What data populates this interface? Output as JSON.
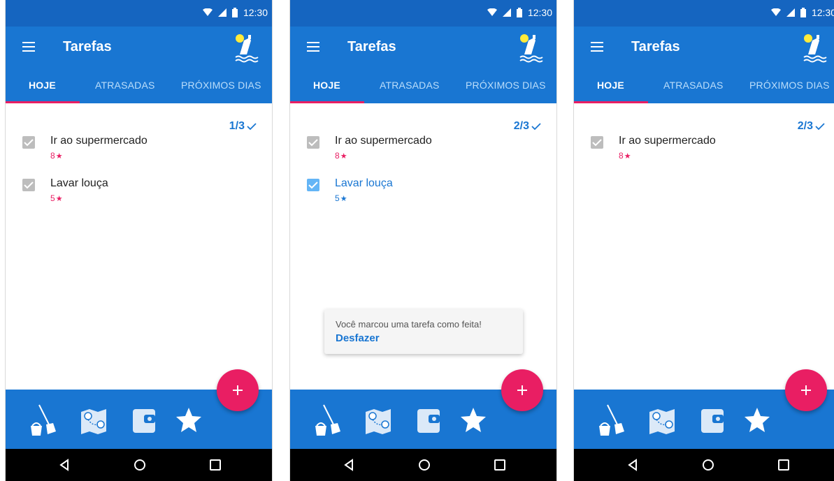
{
  "colors": {
    "status_bar": "#1565c0",
    "app_bar": "#1976d2",
    "accent_pink": "#e91e63",
    "checkbox_gray": "#bdbdbd",
    "checkbox_blue": "#64b5f6",
    "snackbar_bg": "#f5f5f5"
  },
  "screens": [
    {
      "status": {
        "time": "12:30",
        "icons": [
          "wifi-icon",
          "cell-signal-icon",
          "battery-icon"
        ]
      },
      "app": {
        "title": "Tarefas",
        "logo_icon": "bottle-logo-icon"
      },
      "tabs": [
        {
          "label": "HOJE",
          "active": true
        },
        {
          "label": "ATRASADAS",
          "active": false
        },
        {
          "label": "PRÓXIMOS DIAS",
          "active": false
        }
      ],
      "count": "1/3",
      "tasks": [
        {
          "title": "Ir ao supermercado",
          "stars": "8",
          "checked": false,
          "highlight": false
        },
        {
          "title": "Lavar louça",
          "stars": "5",
          "checked": false,
          "highlight": false
        }
      ],
      "bottom_nav": [
        "broom-bucket-icon",
        "map-icon",
        "wallet-icon",
        "star-icon"
      ],
      "fab_icon": "plus-icon",
      "system_nav": [
        "back-icon",
        "home-icon",
        "recents-icon"
      ]
    },
    {
      "status": {
        "time": "12:30",
        "icons": [
          "wifi-icon",
          "cell-signal-icon",
          "battery-icon"
        ]
      },
      "app": {
        "title": "Tarefas",
        "logo_icon": "bottle-logo-icon"
      },
      "tabs": [
        {
          "label": "HOJE",
          "active": true
        },
        {
          "label": "ATRASADAS",
          "active": false
        },
        {
          "label": "PRÓXIMOS DIAS",
          "active": false
        }
      ],
      "count": "2/3",
      "tasks": [
        {
          "title": "Ir ao supermercado",
          "stars": "8",
          "checked": false,
          "highlight": false
        },
        {
          "title": "Lavar louça",
          "stars": "5",
          "checked": true,
          "highlight": true
        }
      ],
      "snackbar": {
        "message": "Você marcou uma tarefa como feita!",
        "action": "Desfazer"
      },
      "bottom_nav": [
        "broom-bucket-icon",
        "map-icon",
        "wallet-icon",
        "star-icon"
      ],
      "fab_icon": "plus-icon",
      "system_nav": [
        "back-icon",
        "home-icon",
        "recents-icon"
      ]
    },
    {
      "status": {
        "time": "12:30",
        "icons": [
          "wifi-icon",
          "cell-signal-icon",
          "battery-icon"
        ]
      },
      "app": {
        "title": "Tarefas",
        "logo_icon": "bottle-logo-icon"
      },
      "tabs": [
        {
          "label": "HOJE",
          "active": true
        },
        {
          "label": "ATRASADAS",
          "active": false
        },
        {
          "label": "PRÓXIMOS DIAS",
          "active": false
        }
      ],
      "count": "2/3",
      "tasks": [
        {
          "title": "Ir ao supermercado",
          "stars": "8",
          "checked": false,
          "highlight": false
        }
      ],
      "bottom_nav": [
        "broom-bucket-icon",
        "map-icon",
        "wallet-icon",
        "star-icon"
      ],
      "fab_icon": "plus-icon",
      "system_nav": [
        "back-icon",
        "home-icon",
        "recents-icon"
      ]
    }
  ]
}
